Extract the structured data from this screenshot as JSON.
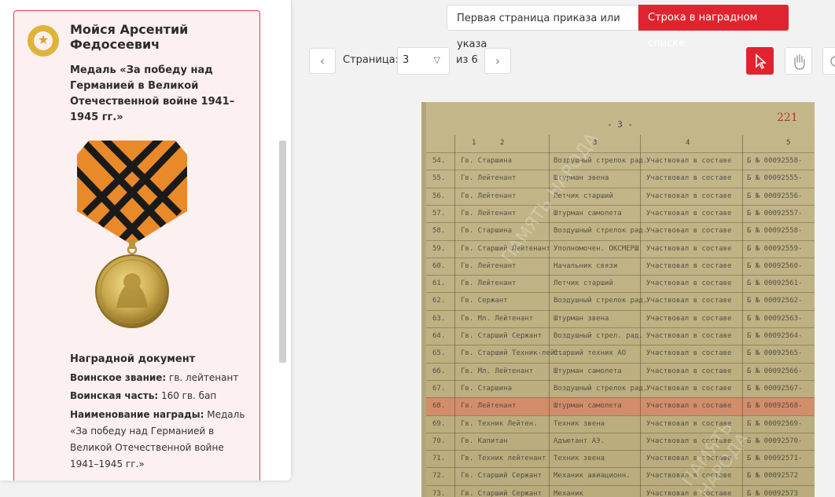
{
  "person": {
    "name": "Мойся Арсентий Федосеевич",
    "award_title": "Медаль «За победу над Германией в Великой Отечественной войне 1941–1945 гг.»"
  },
  "document": {
    "heading": "Наградной документ",
    "rank_label": "Воинское звание:",
    "rank_value": "гв. лейтенант",
    "unit_label": "Воинская часть:",
    "unit_value": "160 гв. бап",
    "award_name_label": "Наименование награды:",
    "award_name_value": "Медаль «За победу над Германией в Великой Отечественной войне 1941–1945 гг.»"
  },
  "tabs": {
    "first_page": "Первая страница приказа или указа",
    "award_row": "Строка в наградном списке"
  },
  "pager": {
    "label": "Страница:",
    "current": "3",
    "of": "из 6",
    "prev_icon": "chevron-left-icon",
    "next_icon": "chevron-right-icon"
  },
  "scan": {
    "page_mark": "- 3 -",
    "stamp": "221",
    "columns": [
      "1",
      "2",
      "3",
      "4",
      "5"
    ],
    "rows": [
      {
        "n": "54.",
        "rank": "Гв. Старшина",
        "post": "Воздушный стрелок рад.",
        "service": "Участвовал в составе",
        "num": "Б № 00092558-"
      },
      {
        "n": "55.",
        "rank": "Гв. Лейтенант",
        "post": "Штурман звена",
        "service": "Участвовал в составе",
        "num": "Б № 00092555-"
      },
      {
        "n": "56.",
        "rank": "Гв. Лейтенант",
        "post": "Летчик старший",
        "service": "Участвовал в составе",
        "num": "Б № 00092556-"
      },
      {
        "n": "57.",
        "rank": "Гв. Лейтенант",
        "post": "Штурман самолета",
        "service": "Участвовал в составе",
        "num": "Б № 00092557-"
      },
      {
        "n": "58.",
        "rank": "Гв. Старшина",
        "post": "Воздушный стрелок рад.",
        "service": "Участвовал в составе",
        "num": "Б № 00092558-"
      },
      {
        "n": "59.",
        "rank": "Гв. Старший Лейтенант",
        "post": "Уполномочен. ОКСМЕРШ",
        "service": "Участвовал в составе",
        "num": "Б № 00092559-"
      },
      {
        "n": "60.",
        "rank": "Гв. Лейтенант",
        "post": "Начальник связи",
        "service": "Участвовал в составе",
        "num": "Б № 00092560-"
      },
      {
        "n": "61.",
        "rank": "Гв. Лейтенант",
        "post": "Летчик старший",
        "service": "Участвовал в составе",
        "num": "Б № 00092561-"
      },
      {
        "n": "62.",
        "rank": "Гв. Сержант",
        "post": "Воздушный стрелок рад.",
        "service": "Участвовал в составе",
        "num": "Б № 00092562-"
      },
      {
        "n": "63.",
        "rank": "Гв. Мл. Лейтенант",
        "post": "Штурман звена",
        "service": "Участвовал в составе",
        "num": "Б № 00092563-"
      },
      {
        "n": "64.",
        "rank": "Гв. Старший Сержант",
        "post": "Воздушный стрел. рад.",
        "service": "Участвовал в составе",
        "num": "Б № 00092564-"
      },
      {
        "n": "65.",
        "rank": "Гв. Старший Техник-лейт.",
        "post": "Старший техник АО",
        "service": "Участвовал в составе",
        "num": "Б № 00092565-"
      },
      {
        "n": "66.",
        "rank": "Гв. Мл. Лейтенант",
        "post": "Штурман самолета",
        "service": "Участвовал в составе",
        "num": "Б № 00092566-"
      },
      {
        "n": "67.",
        "rank": "Гв. Старшина",
        "post": "Воздушный стрелок рад.",
        "service": "Участвовал в составе",
        "num": "Б № 00092567-"
      },
      {
        "n": "68.",
        "rank": "Гв. Лейтенант",
        "post": "Штурман самолета",
        "service": "Участвовал в составе",
        "num": "Б № 00092568-"
      },
      {
        "n": "69.",
        "rank": "Гв. Техник Лейтен.",
        "post": "Техник звена",
        "service": "Участвовал в составе",
        "num": "Б № 00092569-"
      },
      {
        "n": "70.",
        "rank": "Гв. Капитан",
        "post": "Адъютант АЭ.",
        "service": "Участвовал в составе",
        "num": "Б № 00092570-"
      },
      {
        "n": "71.",
        "rank": "Гв. Техник лейтенант",
        "post": "Техник звена",
        "service": "Участвовал в составе",
        "num": "Б № 00092571-"
      },
      {
        "n": "72.",
        "rank": "Гв. Старший Сержант",
        "post": "Механик авиационн.",
        "service": "Участвовал в составе",
        "num": "Б № 00092572"
      },
      {
        "n": "73.",
        "rank": "Гв. Старший Сержант",
        "post": "Механик",
        "service": "Участвовал в составе",
        "num": "Б № 00092573"
      }
    ],
    "highlight_row_index": 14,
    "watermark": "ПАМЯТЬ НАРОДА"
  },
  "colors": {
    "accent": "#e0242f",
    "card_bg": "#fdf0f0",
    "badge": "#e0b43a",
    "highlight": "#ff5046"
  }
}
